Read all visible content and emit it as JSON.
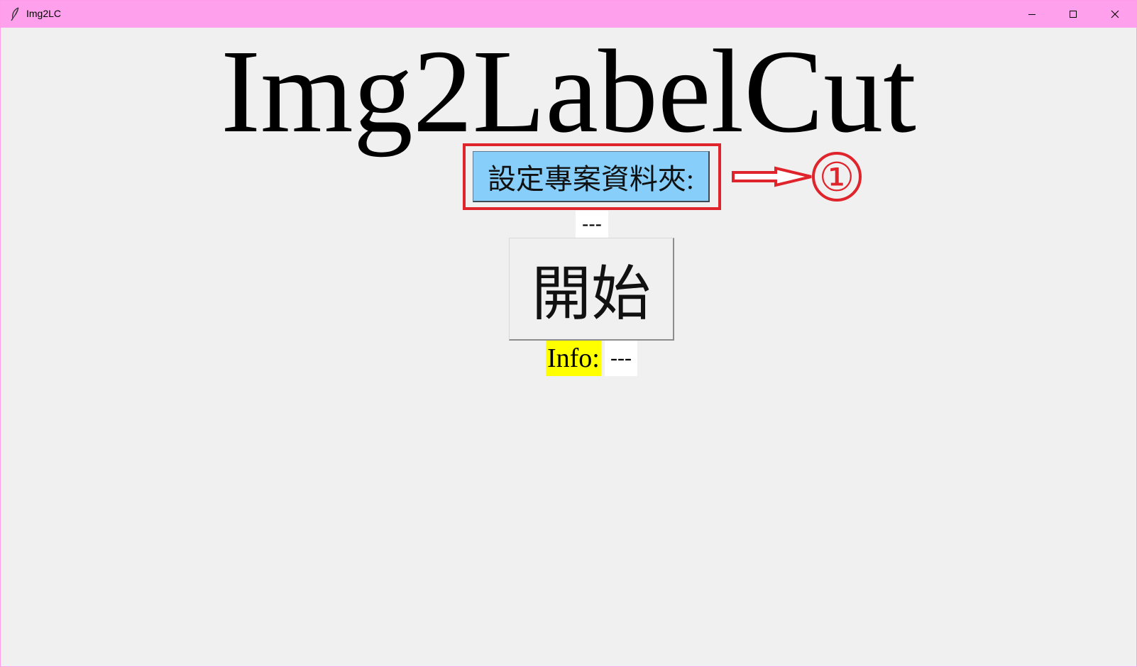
{
  "window": {
    "title": "Img2LC",
    "titlebar_color": "#ffa0ec"
  },
  "main": {
    "title": "Img2LabelCut",
    "set_folder_button_label": "設定專案資料夾:",
    "set_folder_button_color": "#87cefa",
    "folder_path_value": "---",
    "start_button_label": "開始",
    "info_label": "Info:",
    "info_value": "---",
    "info_label_color": "#ffff00"
  },
  "annotation": {
    "step_marker": "①",
    "color": "#e0242c"
  }
}
